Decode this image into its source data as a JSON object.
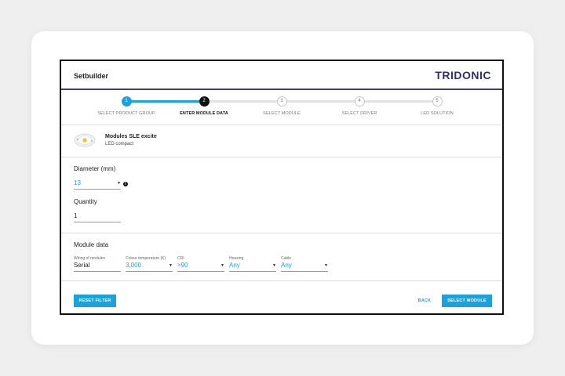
{
  "header": {
    "title": "Setbuilder",
    "logo": "TRIDONIC"
  },
  "steps": [
    {
      "number": "1",
      "label": "SELECT PRODUCT GROUP",
      "state": "done"
    },
    {
      "number": "2",
      "label": "ENTER MODULE DATA",
      "state": "active"
    },
    {
      "number": "3",
      "label": "SELECT MODULE",
      "state": "todo"
    },
    {
      "number": "4",
      "label": "SELECT DRIVER",
      "state": "todo"
    },
    {
      "number": "5",
      "label": "LED SOLUTION",
      "state": "todo"
    }
  ],
  "product": {
    "name": "Modules SLE excite",
    "subtitle": "LED compact",
    "image_icon": "led-module-image"
  },
  "diameter": {
    "label": "Diameter (mm)",
    "value": "13"
  },
  "quantity": {
    "label": "Quantity",
    "value": "1"
  },
  "module_data": {
    "heading": "Module data",
    "fields": [
      {
        "label": "Wiring of modules",
        "value": "Serial"
      },
      {
        "label": "Colour temperature (K)",
        "value": "3,000"
      },
      {
        "label": "CRI",
        "value": ">90"
      },
      {
        "label": "Housing",
        "value": "Any"
      },
      {
        "label": "Cable",
        "value": "Any"
      }
    ]
  },
  "footer": {
    "reset": "RESET FILTER",
    "back": "BACK",
    "select": "SELECT MODULE"
  },
  "colors": {
    "accent": "#1aa1de",
    "brand": "#2f2f6e",
    "active_step": "#111111"
  }
}
